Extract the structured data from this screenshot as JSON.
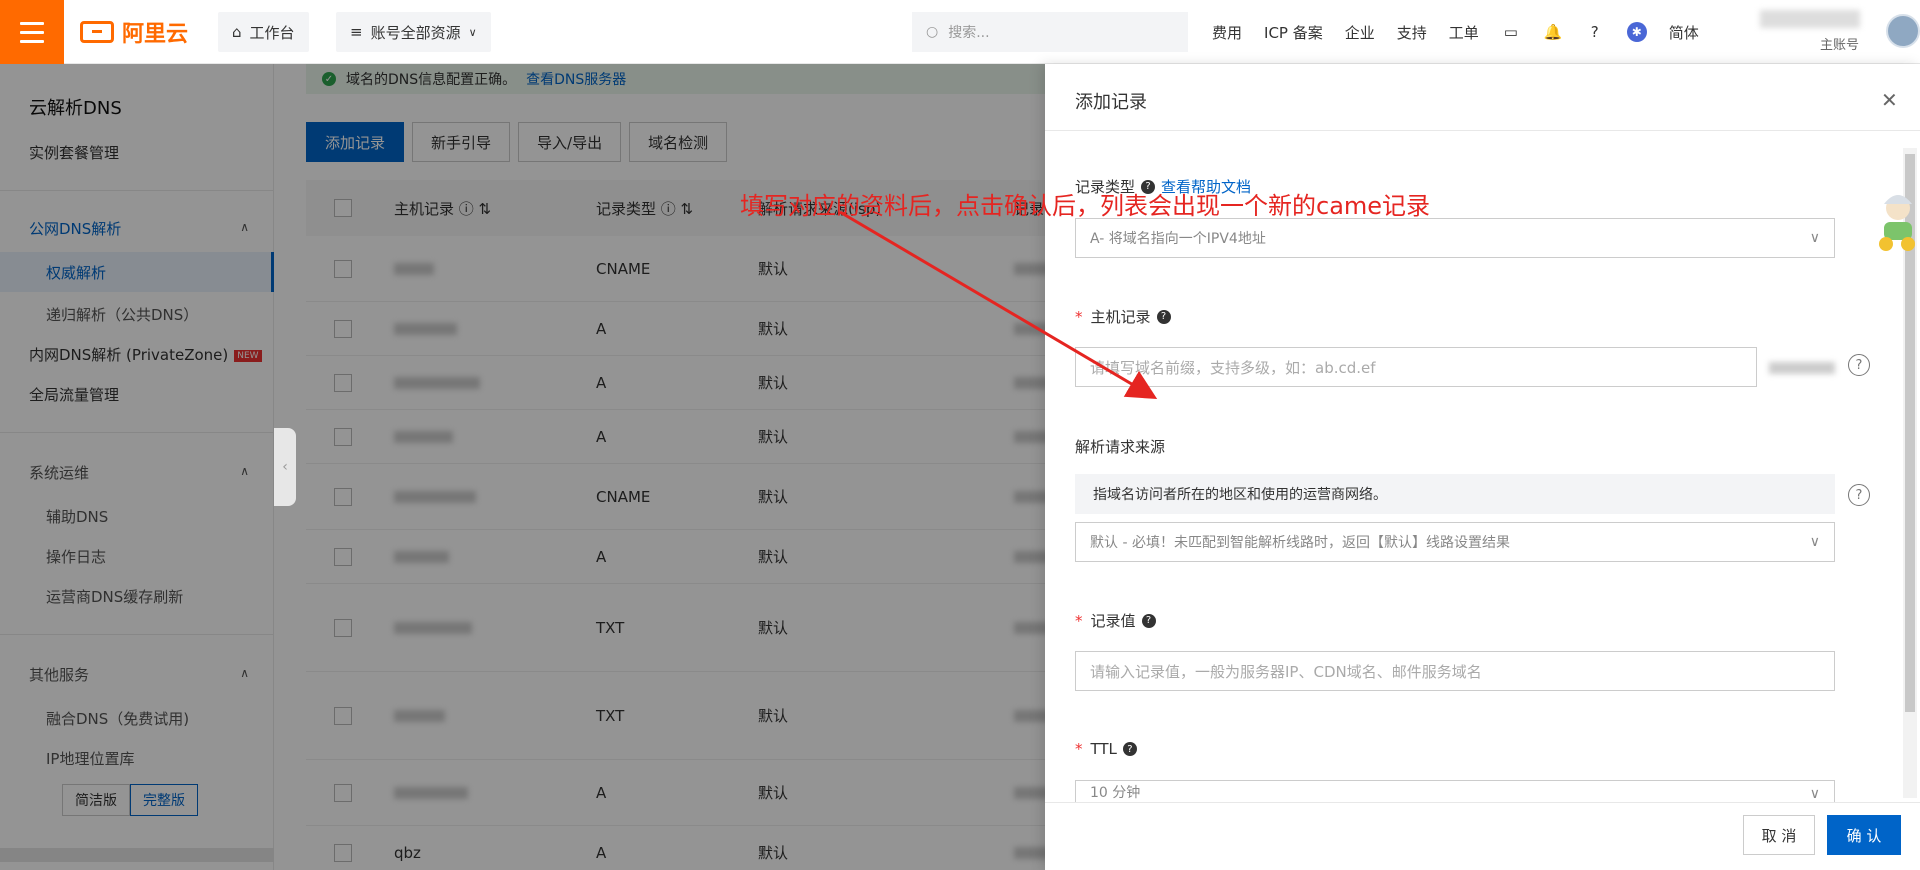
{
  "header": {
    "logo_text": "阿里云",
    "workbench": "工作台",
    "resources": "账号全部资源",
    "search_placeholder": "搜索...",
    "links": [
      "费用",
      "ICP 备案",
      "企业",
      "支持",
      "工单"
    ],
    "lang": "简体",
    "user_sub": "主账号"
  },
  "sidebar": {
    "title": "云解析DNS",
    "instance": "实例套餐管理",
    "public_group": "公网DNS解析",
    "authoritative": "权威解析",
    "recursive": "递归解析（公共DNS）",
    "private_zone": "内网DNS解析 (PrivateZone)",
    "new_badge": "NEW",
    "traffic": "全局流量管理",
    "ops_group": "系统运维",
    "aux_dns": "辅助DNS",
    "op_log": "操作日志",
    "isp_refresh": "运营商DNS缓存刷新",
    "other_group": "其他服务",
    "fusion": "融合DNS（免费试用)",
    "ipgeo": "IP地理位置库",
    "simple": "简洁版",
    "full": "完整版"
  },
  "main": {
    "alert_text": "域名的DNS信息配置正确。",
    "alert_link": "查看DNS服务器",
    "buttons": {
      "add": "添加记录",
      "guide": "新手引导",
      "import": "导入/导出",
      "check": "域名检测"
    },
    "columns": {
      "host": "主机记录",
      "type": "记录类型",
      "line": "解析请求来源(isp)",
      "value": "记录值"
    },
    "rows": [
      {
        "host": "",
        "type": "CNAME",
        "line": "默认"
      },
      {
        "host": "",
        "type": "A",
        "line": "默认"
      },
      {
        "host": "",
        "type": "A",
        "line": "默认"
      },
      {
        "host": "",
        "type": "A",
        "line": "默认"
      },
      {
        "host": "",
        "type": "CNAME",
        "line": "默认"
      },
      {
        "host": "",
        "type": "A",
        "line": "默认"
      },
      {
        "host": "",
        "type": "TXT",
        "line": "默认"
      },
      {
        "host": "",
        "type": "TXT",
        "line": "默认"
      },
      {
        "host": "",
        "type": "A",
        "line": "默认"
      },
      {
        "host": "qbz",
        "type": "A",
        "line": "默认"
      }
    ]
  },
  "drawer": {
    "title": "添加记录",
    "record_type_label": "记录类型",
    "help_link": "查看帮助文档",
    "record_type_value": "A- 将域名指向一个IPV4地址",
    "host_label": "主机记录",
    "host_placeholder": "请填写域名前缀，支持多级，如：ab.cd.ef",
    "source_label": "解析请求来源",
    "source_hint": "指域名访问者所在的地区和使用的运营商网络。",
    "source_value": "默认 - 必填！未匹配到智能解析线路时，返回【默认】线路设置结果",
    "value_label": "记录值",
    "value_placeholder": "请输入记录值，一般为服务器IP、CDN域名、邮件服务域名",
    "ttl_label": "TTL",
    "ttl_value": "10 分钟",
    "cancel": "取 消",
    "confirm": "确 认"
  },
  "annotation": "填写对应的资料后，点击确认后，列表会出现一个新的came记录",
  "colors": {
    "brand": "#ff6a00",
    "primary": "#0064c8",
    "annotation": "#e52521"
  }
}
